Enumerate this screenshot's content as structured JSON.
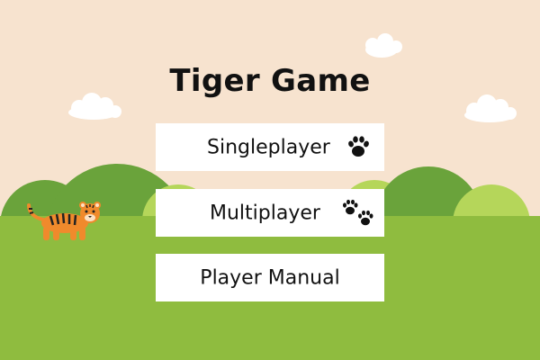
{
  "game": {
    "title": "Tiger Game"
  },
  "menu": {
    "singleplayer_label": "Singleplayer",
    "multiplayer_label": "Multiplayer",
    "manual_label": "Player Manual"
  },
  "icons": {
    "singleplayer": "paw-icon",
    "multiplayer": "paws-icon",
    "mascot": "tiger-icon"
  },
  "colors": {
    "sky": "#f7e3cf",
    "grass": "#8fbc3f",
    "hill_dark": "#6aa33b",
    "hill_light": "#b5d65a",
    "button_bg": "#ffffff",
    "text": "#111111",
    "tiger_orange": "#f08a2c"
  }
}
